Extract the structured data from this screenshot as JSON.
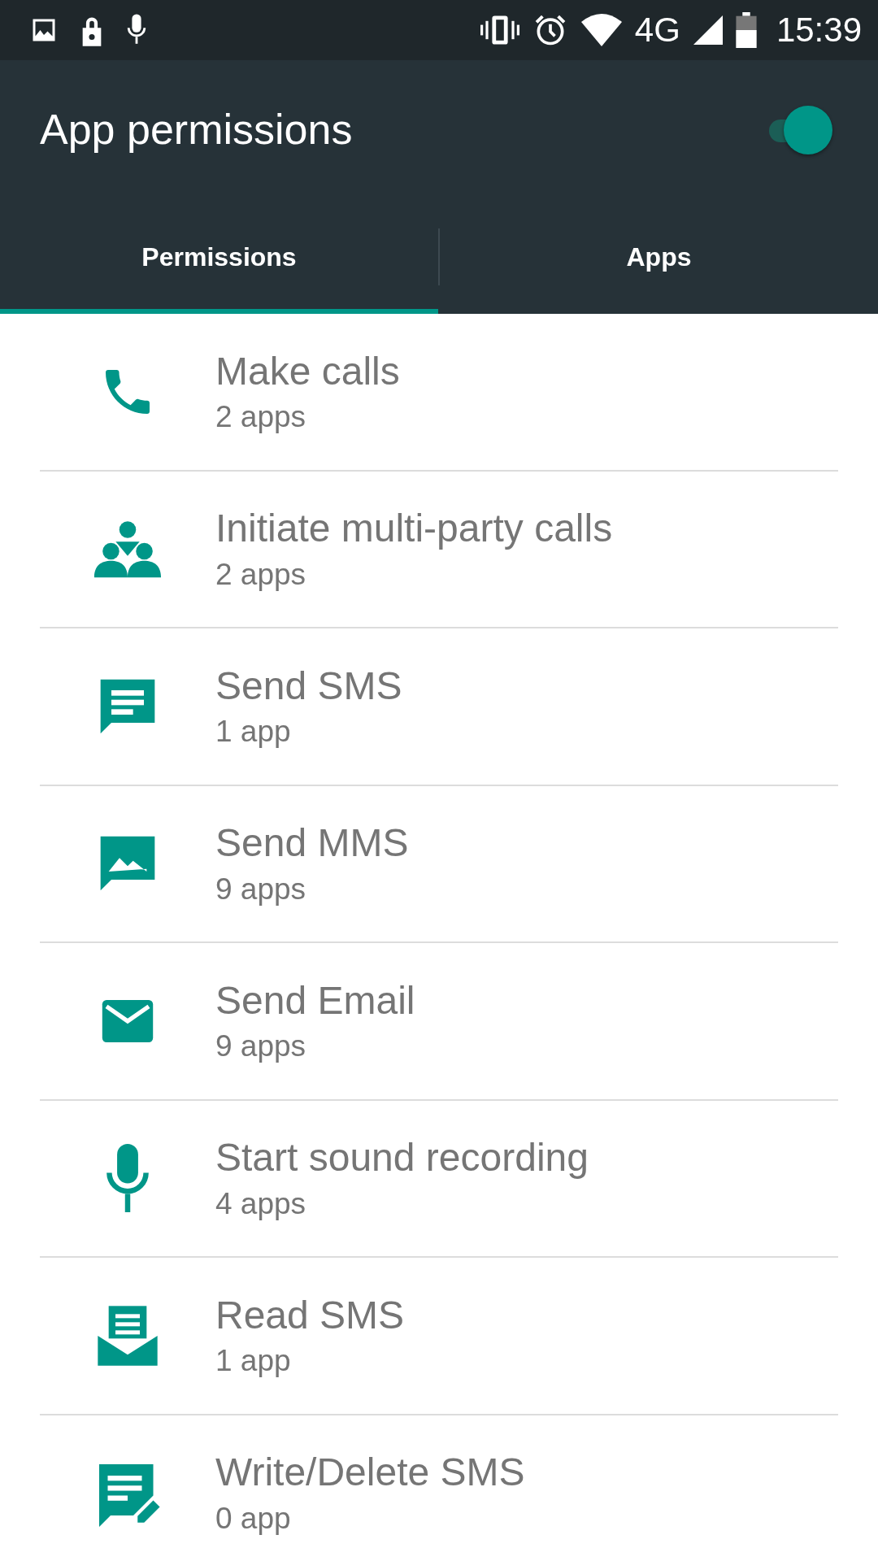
{
  "status_bar": {
    "network": "4G",
    "time": "15:39"
  },
  "app_bar": {
    "title": "App permissions",
    "switch_on": true
  },
  "tabs": [
    {
      "label": "Permissions",
      "selected": true
    },
    {
      "label": "Apps",
      "selected": false
    }
  ],
  "permissions": [
    {
      "title": "Make calls",
      "count": "2 apps"
    },
    {
      "title": "Initiate multi-party calls",
      "count": "2 apps"
    },
    {
      "title": "Send SMS",
      "count": "1 app"
    },
    {
      "title": "Send MMS",
      "count": "9 apps"
    },
    {
      "title": "Send Email",
      "count": "9 apps"
    },
    {
      "title": "Start sound recording",
      "count": "4 apps"
    },
    {
      "title": "Read SMS",
      "count": "1 app"
    },
    {
      "title": "Write/Delete SMS",
      "count": "0 app"
    }
  ]
}
